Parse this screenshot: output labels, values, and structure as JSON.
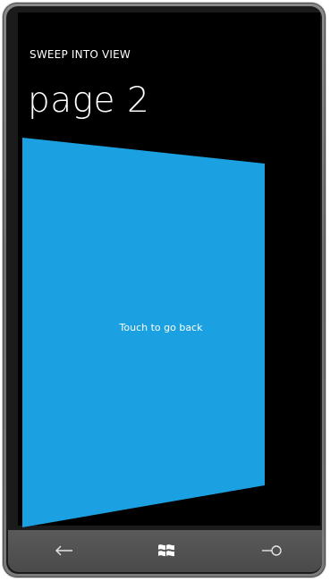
{
  "app": {
    "title": "SWEEP INTO VIEW",
    "page_title": "page 2"
  },
  "panel": {
    "label": "Touch to go back",
    "color": "#1BA1E2"
  },
  "navbar": {
    "back_icon": "back-arrow-icon",
    "start_icon": "windows-logo-icon",
    "search_icon": "search-icon"
  }
}
